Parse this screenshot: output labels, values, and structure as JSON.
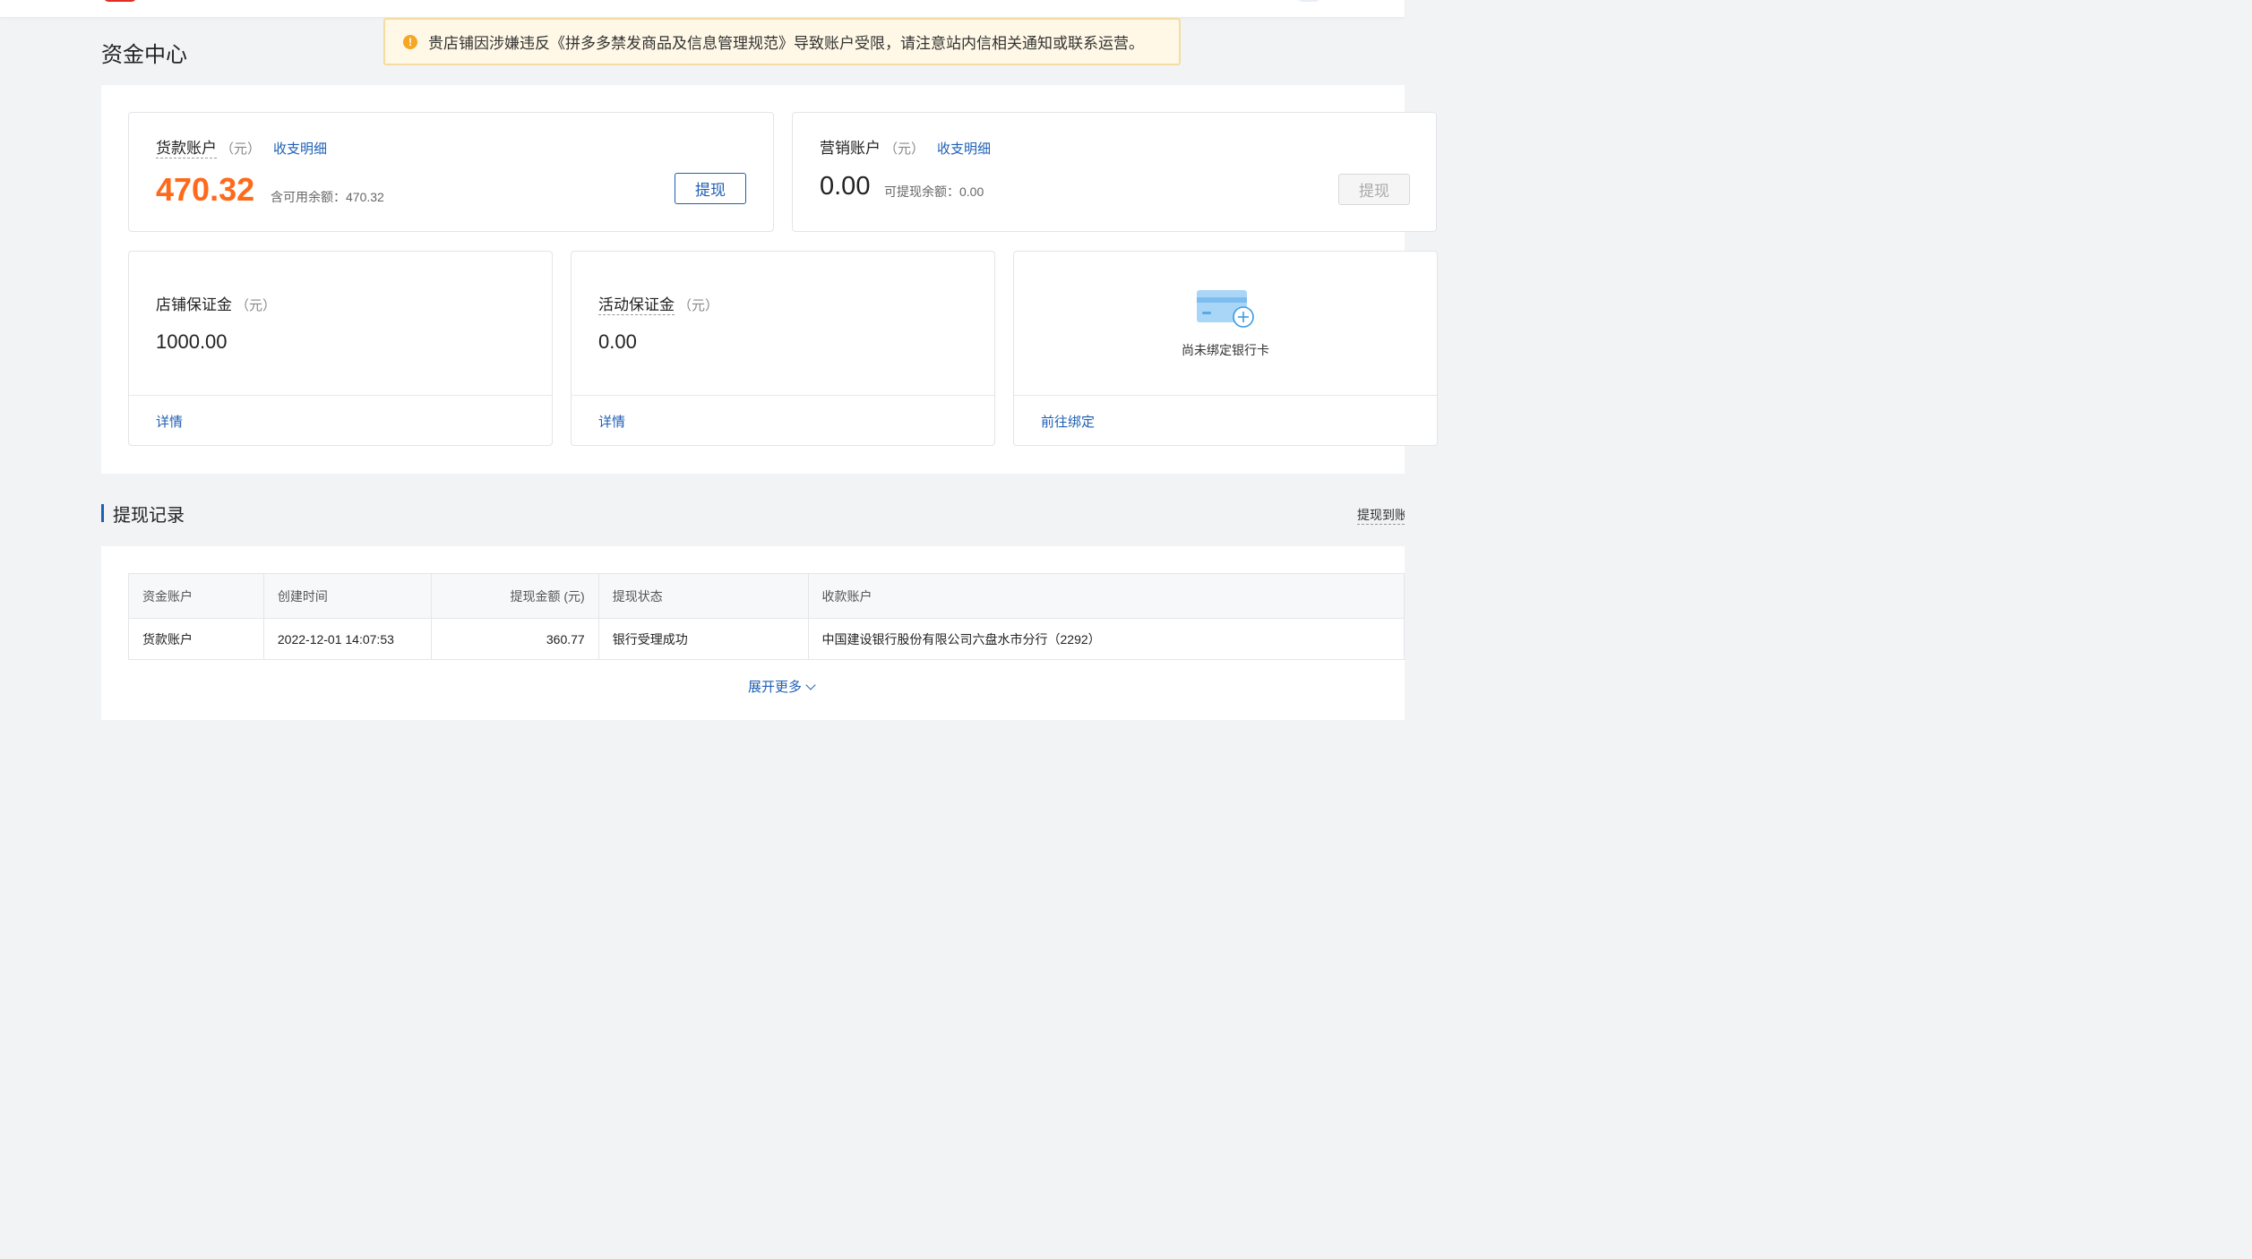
{
  "header": {
    "page_title": "资金中心"
  },
  "alert": {
    "icon": "warning-icon",
    "message": "贵店铺因涉嫌违反《拼多多禁发商品及信息管理规范》导致账户受限，请注意站内信相关通知或联系运营。"
  },
  "goods_account": {
    "name": "货款账户",
    "unit": "（元）",
    "detail_link": "收支明细",
    "amount": "470.32",
    "available_label": "含可用余额：470.32",
    "withdraw_button": "提现"
  },
  "marketing_account": {
    "name": "营销账户",
    "unit": "（元）",
    "detail_link": "收支明细",
    "amount": "0.00",
    "withdrawable_label": "可提现余额：0.00",
    "withdraw_button": "提现"
  },
  "shop_deposit": {
    "name": "店铺保证金",
    "unit": "（元）",
    "amount": "1000.00",
    "detail_link": "详情"
  },
  "activity_deposit": {
    "name": "活动保证金",
    "unit": "（元）",
    "amount": "0.00",
    "detail_link": "详情"
  },
  "bank_card": {
    "icon": "bank-card-add-icon",
    "status_text": "尚未绑定银行卡",
    "bind_link": "前往绑定"
  },
  "withdraw_records": {
    "title": "提现记录",
    "right_link": "提现到账",
    "columns": [
      "资金账户",
      "创建时间",
      "提现金额 (元)",
      "提现状态",
      "收款账户"
    ],
    "rows": [
      [
        "货款账户",
        "2022-12-01 14:07:53",
        "360.77",
        "银行受理成功",
        "中国建设银行股份有限公司六盘水市分行（2292）"
      ]
    ],
    "expand_more": "展开更多"
  },
  "colors": {
    "accent": "#1e5fb4",
    "amount_highlight": "#ff6a1a",
    "alert_bg": "#fff8e6",
    "alert_icon": "#f5a623"
  }
}
